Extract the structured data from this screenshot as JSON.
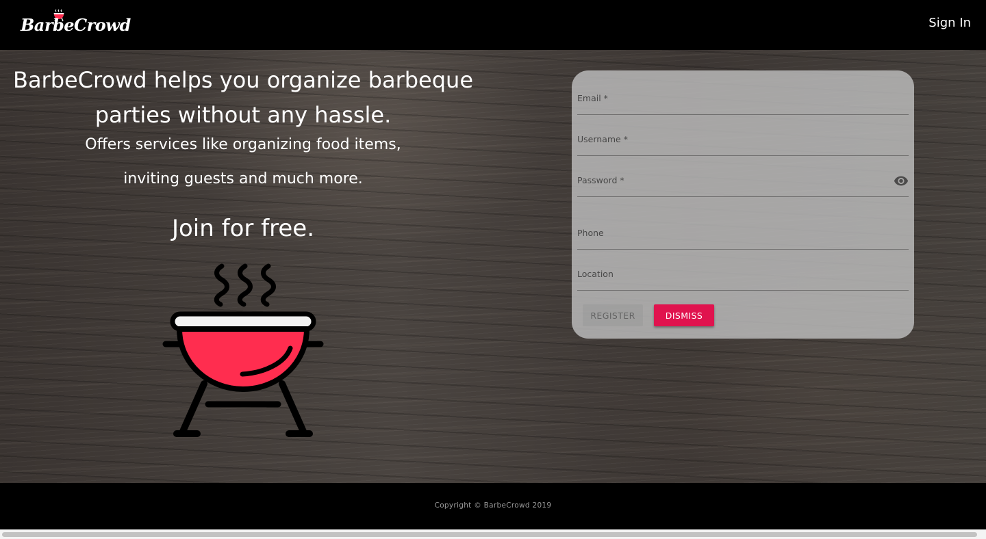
{
  "header": {
    "brand": "BarbeCrowd",
    "sign_in_label": "Sign In"
  },
  "hero": {
    "headline": "BarbeCrowd helps you organize barbeque parties without any hassle.",
    "subtext_line1": "Offers services like organizing food items,",
    "subtext_line2": "inviting guests and much more.",
    "cta": "Join for free.",
    "grill_icon": "grill-icon"
  },
  "form": {
    "email_label": "Email *",
    "email_value": "",
    "username_label": "Username *",
    "username_value": "",
    "password_label": "Password *",
    "password_value": "",
    "password_toggle_icon": "eye-icon",
    "phone_label": "Phone",
    "phone_value": "",
    "location_label": "Location",
    "location_value": "",
    "register_label": "REGISTER",
    "dismiss_label": "DISMISS"
  },
  "footer": {
    "copyright": "Copyright © BarbeCrowd 2019"
  },
  "colors": {
    "accent": "#e0134e",
    "grill_red": "#ff2d4f",
    "header_bg": "#000000"
  }
}
